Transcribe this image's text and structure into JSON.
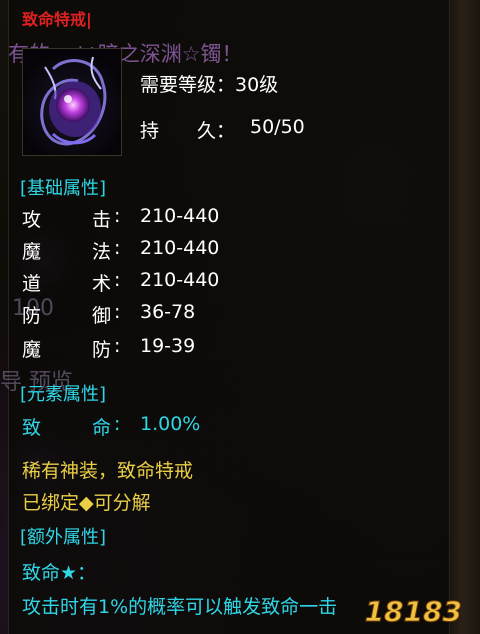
{
  "item": {
    "name": "致命特戒|",
    "background_banner": "有的 ...い暗之深渊☆镯！",
    "level_required": "需要等级：30级",
    "durability_label": "持　　久：",
    "durability_value": "50/50"
  },
  "sections": {
    "base": "[基础属性]",
    "element": "[元素属性]",
    "extra": "[额外属性]"
  },
  "base_stats": [
    {
      "c1": "攻",
      "c2": "击",
      "value": "210-440"
    },
    {
      "c1": "魔",
      "c2": "法",
      "value": "210-440"
    },
    {
      "c1": "道",
      "c2": "术",
      "value": "210-440"
    },
    {
      "c1": "防",
      "c2": "御",
      "value": "36-78"
    },
    {
      "c1": "魔",
      "c2": "防",
      "value": "19-39"
    }
  ],
  "element_stats": [
    {
      "c1": "致",
      "c2": "命",
      "value": "1.00%"
    }
  ],
  "rarity_text": "稀有神装，致命特戒",
  "bind_text": "已绑定◆可分解",
  "extra_stats": {
    "title": "致命★：",
    "desc": "攻击时有1%的概率可以触发致命一击"
  },
  "background_fragments": {
    "left_100": "100",
    "left_preview": "导 预览"
  },
  "watermark": "18183",
  "colors": {
    "name": "#e02020",
    "section": "#2fd6e6",
    "rarity": "#e8cf46"
  }
}
